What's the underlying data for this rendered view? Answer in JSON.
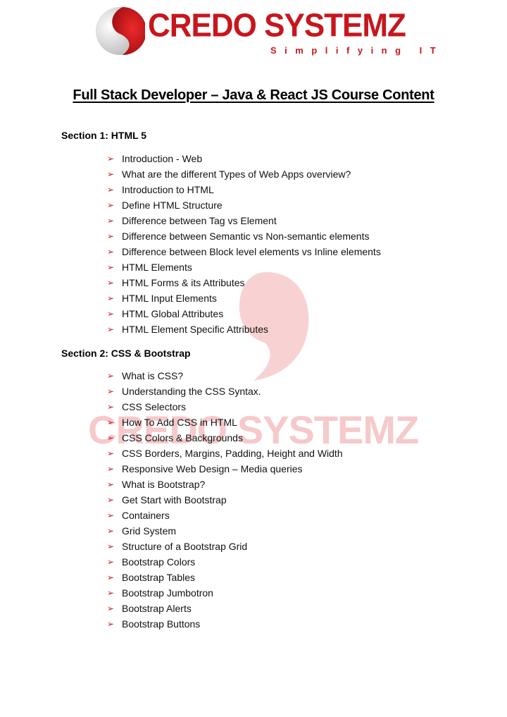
{
  "brand": {
    "name": "CREDO SYSTEMZ",
    "tagline": "Simplifying IT",
    "primary_color": "#c8161d",
    "watermark_color": "#f6c9cb"
  },
  "document": {
    "title": "Full Stack Developer – Java & React JS Course Content"
  },
  "bullet_icon": "arrowhead-right-icon",
  "sections": [
    {
      "title": "Section 1: HTML 5",
      "items": [
        "Introduction - Web",
        "What are the different Types of Web Apps overview?",
        "Introduction to HTML",
        "Define HTML Structure",
        "Difference between Tag vs Element",
        "Difference between Semantic vs Non-semantic elements",
        "Difference between Block level elements vs Inline elements",
        "HTML Elements",
        "HTML Forms & its Attributes",
        "HTML Input Elements",
        "HTML Global Attributes",
        "HTML Element Specific Attributes"
      ]
    },
    {
      "title": "Section 2: CSS & Bootstrap",
      "items": [
        "What is CSS?",
        "Understanding the CSS Syntax.",
        "CSS Selectors",
        "How To Add CSS in HTML",
        "CSS Colors & Backgrounds",
        "CSS Borders, Margins, Padding, Height and Width",
        "Responsive Web Design – Media queries",
        "What is Bootstrap?",
        "Get Start with Bootstrap",
        "Containers",
        "Grid System",
        "Structure of a Bootstrap Grid",
        "Bootstrap Colors",
        "Bootstrap Tables",
        "Bootstrap Jumbotron",
        "Bootstrap Alerts",
        "Bootstrap Buttons"
      ]
    }
  ]
}
